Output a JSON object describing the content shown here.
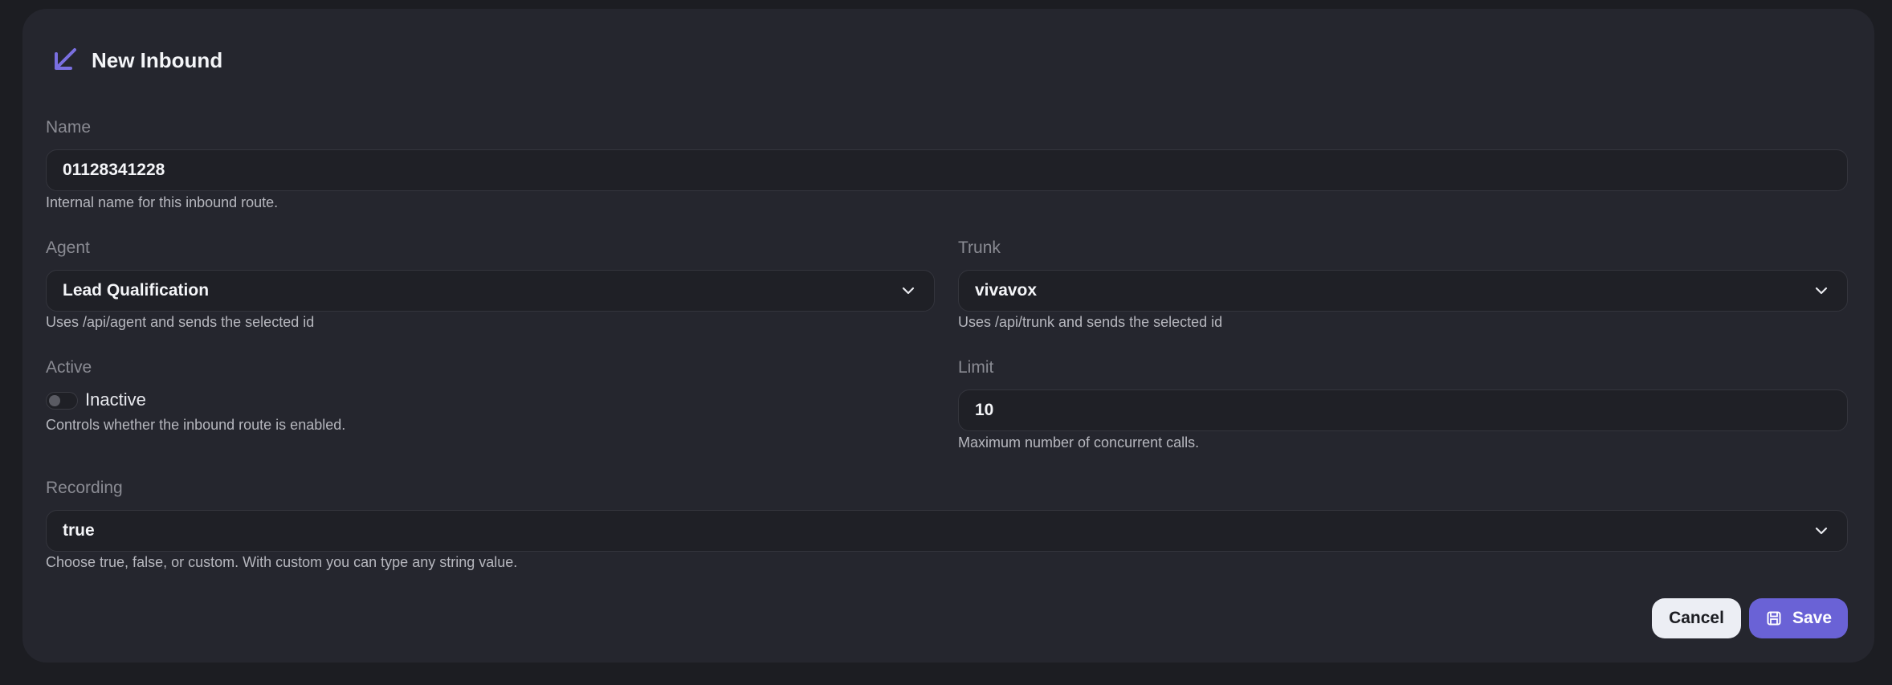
{
  "dialog": {
    "title": "New Inbound",
    "icon": "arrow-down-left-icon"
  },
  "fields": {
    "name": {
      "label": "Name",
      "value": "01128341228",
      "hint": "Internal name for this inbound route."
    },
    "agent": {
      "label": "Agent",
      "value": "Lead Qualification",
      "hint": "Uses /api/agent and sends the selected id"
    },
    "trunk": {
      "label": "Trunk",
      "value": "vivavox",
      "hint": "Uses /api/trunk and sends the selected id"
    },
    "active": {
      "label": "Active",
      "state_label": "Inactive",
      "hint": "Controls whether the inbound route is enabled."
    },
    "limit": {
      "label": "Limit",
      "value": "10",
      "hint": "Maximum number of concurrent calls."
    },
    "recording": {
      "label": "Recording",
      "value": "true",
      "hint": "Choose true, false, or custom. With custom you can type any string value."
    }
  },
  "actions": {
    "cancel_label": "Cancel",
    "save_label": "Save"
  },
  "colors": {
    "accent": "#6a62d6",
    "background": "#1c1d22",
    "card": "#25262e"
  }
}
